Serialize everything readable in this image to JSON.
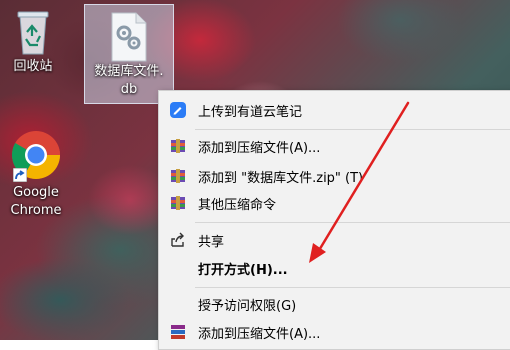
{
  "desktop": {
    "icons": [
      {
        "label": "回收站"
      },
      {
        "label": "数据库文件.\ndb"
      },
      {
        "label": "Google\nChrome"
      }
    ]
  },
  "context_menu": {
    "items": [
      {
        "label": "上传到有道云笔记",
        "icon": "youdao-note-icon"
      },
      {
        "label": "添加到压缩文件(A)...",
        "icon": "winrar-archive-icon"
      },
      {
        "label": "添加到 \"数据库文件.zip\" (T)",
        "icon": "winrar-archive-icon"
      },
      {
        "label": "其他压缩命令",
        "icon": "winrar-archive-icon",
        "submenu": true
      },
      {
        "label": "共享",
        "icon": "share-icon"
      },
      {
        "label": "打开方式(H)...",
        "bold": true
      },
      {
        "label": "授予访问权限(G)",
        "submenu": true
      },
      {
        "label": "添加到压缩文件(A)...",
        "icon": "winrar-books-icon"
      }
    ],
    "submenu_glyph": "›"
  },
  "colors": {
    "menu_bg": "#f2f2f2",
    "annotation_arrow": "#e02020",
    "youdao_blue": "#2b7cf6"
  }
}
